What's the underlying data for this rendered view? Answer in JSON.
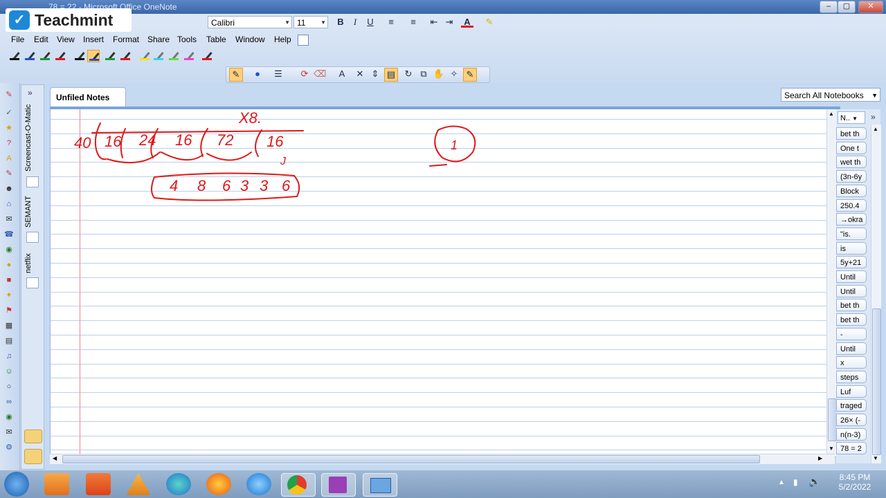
{
  "window": {
    "title": "78 = 22 - Microsoft Office OneNote"
  },
  "watermark": {
    "brand": "Teachmint"
  },
  "menu": {
    "items": [
      "File",
      "Edit",
      "View",
      "Insert",
      "Format",
      "Share",
      "Tools",
      "Table",
      "Window",
      "Help"
    ]
  },
  "format_toolbar": {
    "font": "Calibri",
    "font_size": "11",
    "bold": "B",
    "italic": "I",
    "underline": "U",
    "font_color_label": "A"
  },
  "tabs": {
    "active": "Unfiled Notes"
  },
  "search": {
    "placeholder": "Search All Notebooks"
  },
  "nav_pane": {
    "notebooks": [
      "Screencast-O-Matic",
      "SEMANT",
      "netflix"
    ]
  },
  "page_list": {
    "header": "N..",
    "pages": [
      "bet th",
      "One t",
      "wet th",
      "(3n-6y",
      "Block",
      "250.4",
      "→okra",
      "\"is.",
      "is",
      "5y+21",
      "Until",
      "Until",
      "bet th",
      "bet th",
      "-",
      "Until",
      "x",
      "steps",
      "Luf",
      "traged",
      "26× (-",
      "n(n-3)",
      "78 = 2"
    ]
  },
  "ink": {
    "top_note": "X8.",
    "row1": [
      "40",
      "16",
      "24",
      "16",
      "72",
      "16"
    ],
    "row1_sub": "J",
    "row2": [
      "4",
      "8",
      "6",
      "3",
      "3",
      "6"
    ],
    "circled": "1"
  },
  "taskbar": {
    "time": "8:45 PM",
    "date": "5/2/2022"
  },
  "colors": {
    "ink": "#e01818",
    "accent": "#7ba4d9",
    "margin": "#ee8888"
  }
}
